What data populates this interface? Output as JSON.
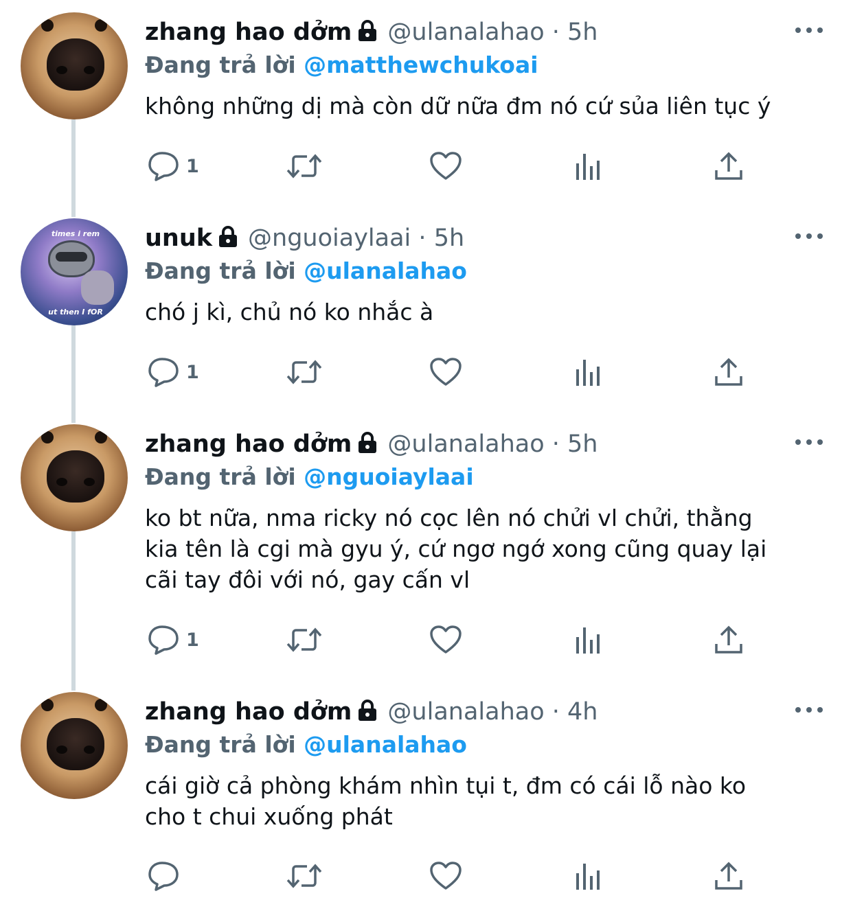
{
  "tweets": [
    {
      "avatar": "dog-nose-photo",
      "name": "zhang hao dởm",
      "handle": "@ulanalahao",
      "dot": "·",
      "time": "5h",
      "replying_label": "Đang trả lời",
      "replying_to": "@matthewchukoai",
      "text": "không những dị mà còn dữ nữa đm nó cứ sủa liên tục ý",
      "reply_count": "1"
    },
    {
      "avatar": "raccoon-space-meme",
      "avatar_caption_top": "times i rem",
      "avatar_caption_bottom": "ut then I fOR",
      "name": "unuk",
      "handle": "@nguoiaylaai",
      "dot": "·",
      "time": "5h",
      "replying_label": "Đang trả lời",
      "replying_to": "@ulanalahao",
      "text": "chó j kì, chủ nó ko nhắc à",
      "reply_count": "1"
    },
    {
      "avatar": "dog-nose-photo",
      "name": "zhang hao dởm",
      "handle": "@ulanalahao",
      "dot": "·",
      "time": "5h",
      "replying_label": "Đang trả lời",
      "replying_to": "@nguoiaylaai",
      "text_lines": [
        "ko bt nữa, nma ricky nó cọc lên nó chửi vl chửi, thằng",
        "kia tên là cgi mà gyu ý, cứ ngơ ngớ xong cũng quay lại",
        "cãi tay đôi với nó, gay cấn vl"
      ],
      "reply_count": "1"
    },
    {
      "avatar": "dog-nose-photo",
      "name": "zhang hao dởm",
      "handle": "@ulanalahao",
      "dot": "·",
      "time": "4h",
      "replying_label": "Đang trả lời",
      "replying_to": "@ulanalahao",
      "text_lines": [
        "cái giờ cả phòng khám nhìn tụi t, đm có cái lỗ nào ko",
        "cho t chui xuống phát"
      ],
      "reply_count": ""
    }
  ],
  "icons": {
    "lock": "lock-icon",
    "more": "more-horizontal-icon",
    "reply": "reply-bubble-icon",
    "retweet": "retweet-icon",
    "like": "heart-icon",
    "views": "analytics-bars-icon",
    "share": "share-upload-icon"
  },
  "colors": {
    "text": "#0f1419",
    "secondary": "#536471",
    "link": "#1d9bf0",
    "thread_line": "#cfd9de"
  }
}
